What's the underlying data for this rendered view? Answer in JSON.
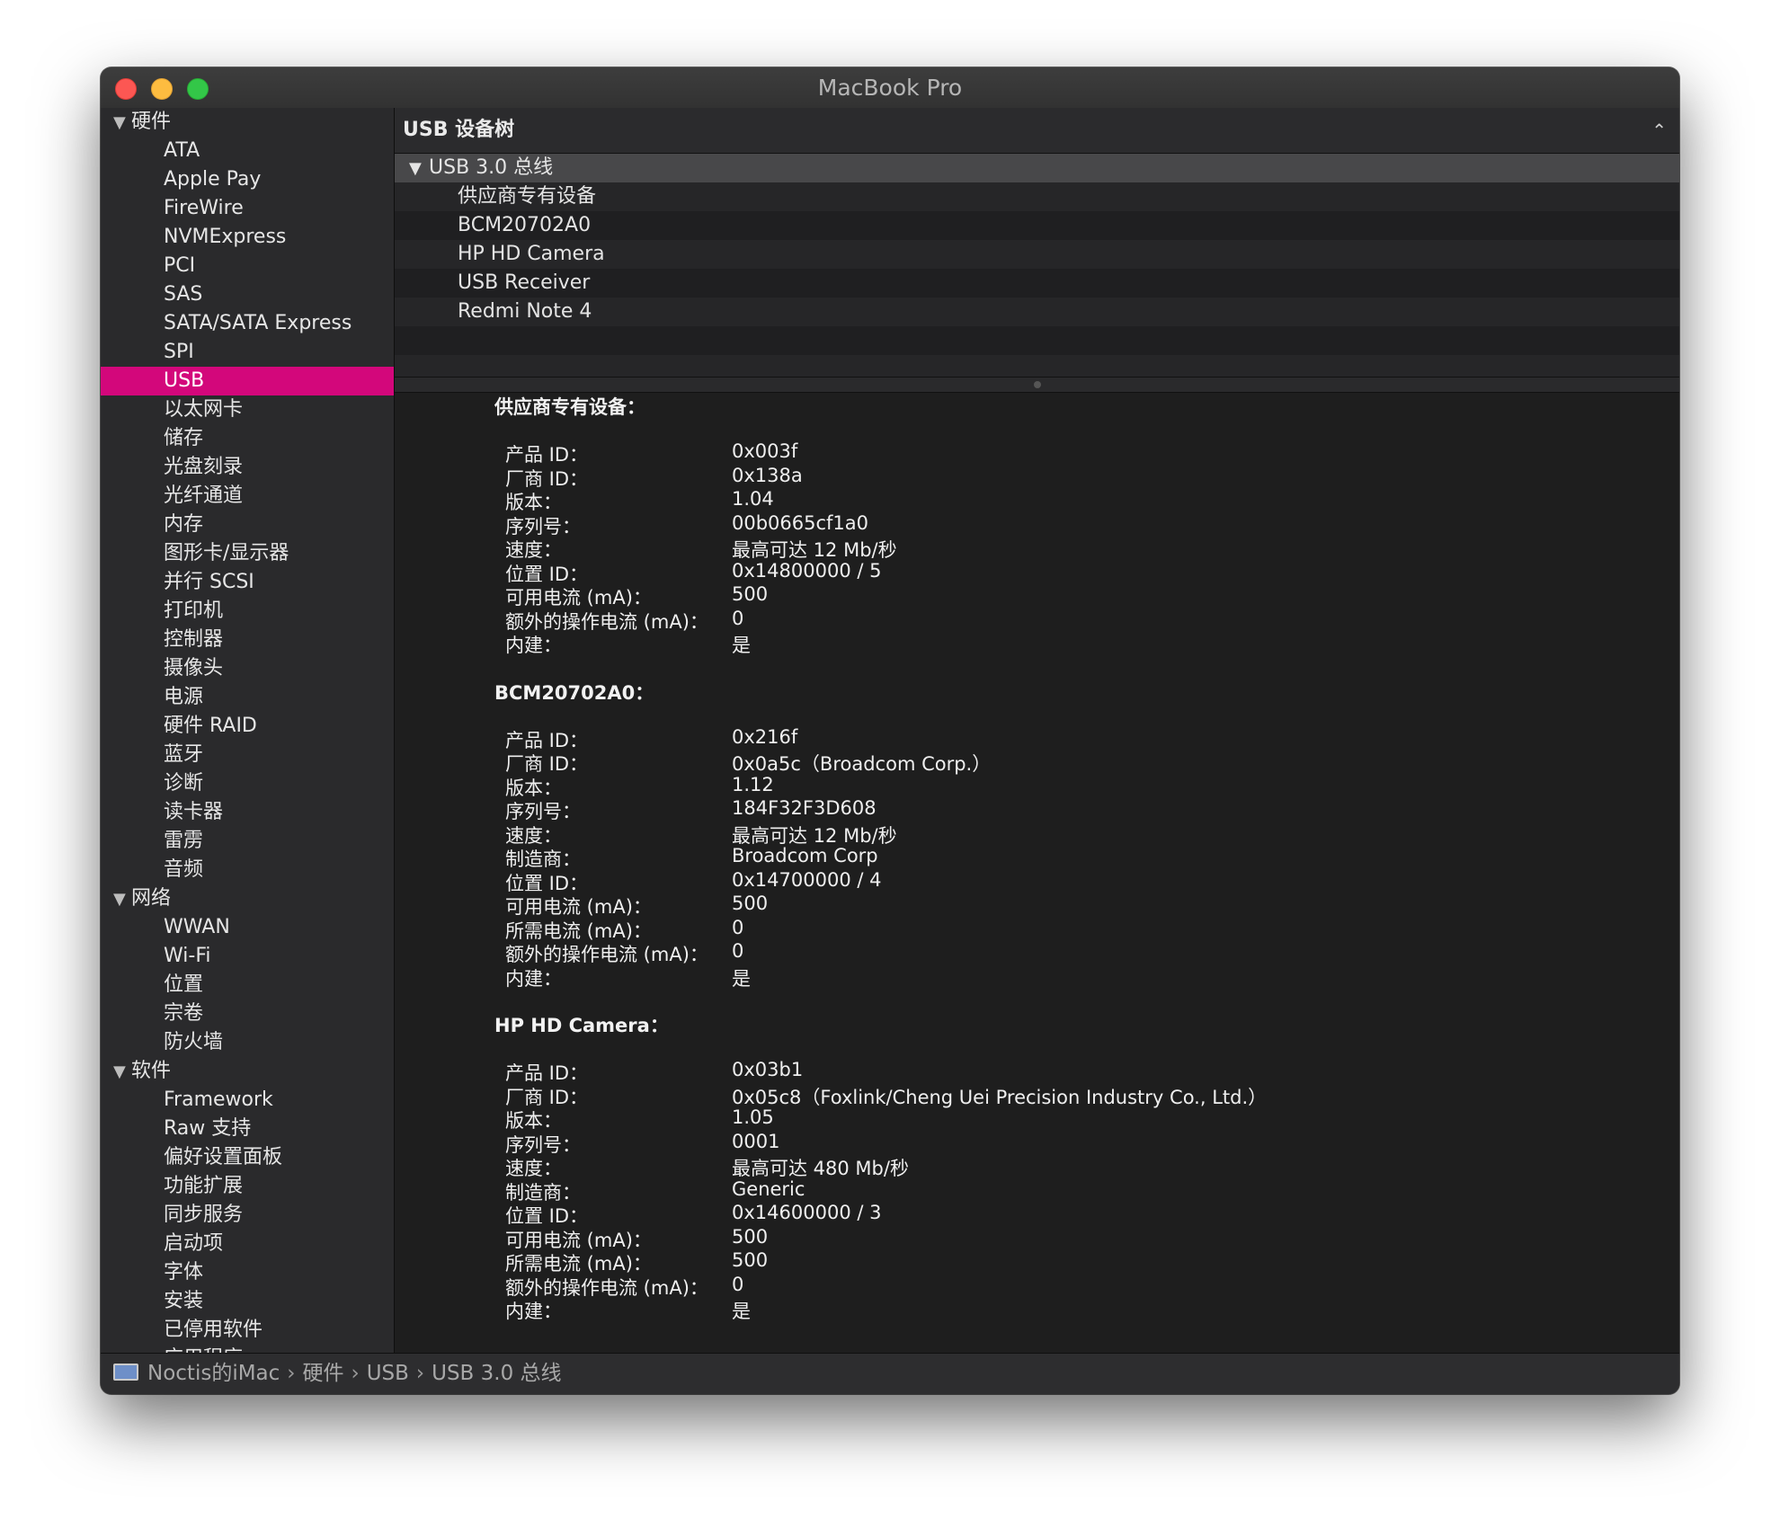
{
  "window": {
    "title": "MacBook Pro"
  },
  "sidebar": {
    "groups": [
      {
        "label": "硬件",
        "items": [
          "ATA",
          "Apple Pay",
          "FireWire",
          "NVMExpress",
          "PCI",
          "SAS",
          "SATA/SATA Express",
          "SPI",
          "USB",
          "以太网卡",
          "储存",
          "光盘刻录",
          "光纤通道",
          "内存",
          "图形卡/显示器",
          "并行 SCSI",
          "打印机",
          "控制器",
          "摄像头",
          "电源",
          "硬件 RAID",
          "蓝牙",
          "诊断",
          "读卡器",
          "雷雳",
          "音频"
        ]
      },
      {
        "label": "网络",
        "items": [
          "WWAN",
          "Wi-Fi",
          "位置",
          "宗卷",
          "防火墙"
        ]
      },
      {
        "label": "软件",
        "items": [
          "Framework",
          "Raw 支持",
          "偏好设置面板",
          "功能扩展",
          "同步服务",
          "启动项",
          "字体",
          "安装",
          "已停用软件",
          "应用程序"
        ]
      }
    ],
    "selected": "USB"
  },
  "tree": {
    "header": "USB 设备树",
    "bus": "USB 3.0 总线",
    "devices": [
      "供应商专有设备",
      "BCM20702A0",
      "HP HD Camera",
      "USB Receiver",
      "Redmi Note 4"
    ]
  },
  "details": [
    {
      "title": "供应商专有设备：",
      "rows": [
        {
          "label": "产品 ID：",
          "value": "0x003f"
        },
        {
          "label": "厂商 ID：",
          "value": "0x138a"
        },
        {
          "label": "版本：",
          "value": "1.04"
        },
        {
          "label": "序列号：",
          "value": "00b0665cf1a0"
        },
        {
          "label": "速度：",
          "value": "最高可达 12 Mb/秒"
        },
        {
          "label": "位置 ID：",
          "value": "0x14800000 / 5"
        },
        {
          "label": "可用电流 (mA)：",
          "value": "500"
        },
        {
          "label": "额外的操作电流 (mA)：",
          "value": "0"
        },
        {
          "label": "内建：",
          "value": "是"
        }
      ]
    },
    {
      "title": "BCM20702A0：",
      "rows": [
        {
          "label": "产品 ID：",
          "value": "0x216f"
        },
        {
          "label": "厂商 ID：",
          "value": "0x0a5c（Broadcom Corp.）"
        },
        {
          "label": "版本：",
          "value": "1.12"
        },
        {
          "label": "序列号：",
          "value": "184F32F3D608"
        },
        {
          "label": "速度：",
          "value": "最高可达 12 Mb/秒"
        },
        {
          "label": "制造商：",
          "value": "Broadcom Corp"
        },
        {
          "label": "位置 ID：",
          "value": "0x14700000 / 4"
        },
        {
          "label": "可用电流 (mA)：",
          "value": "500"
        },
        {
          "label": "所需电流 (mA)：",
          "value": "0"
        },
        {
          "label": "额外的操作电流 (mA)：",
          "value": "0"
        },
        {
          "label": "内建：",
          "value": "是"
        }
      ]
    },
    {
      "title": "HP HD Camera：",
      "rows": [
        {
          "label": "产品 ID：",
          "value": "0x03b1"
        },
        {
          "label": "厂商 ID：",
          "value": "0x05c8（Foxlink/Cheng Uei Precision Industry Co., Ltd.）"
        },
        {
          "label": "版本：",
          "value": "1.05"
        },
        {
          "label": "序列号：",
          "value": "0001"
        },
        {
          "label": "速度：",
          "value": "最高可达 480 Mb/秒"
        },
        {
          "label": "制造商：",
          "value": "Generic"
        },
        {
          "label": "位置 ID：",
          "value": "0x14600000 / 3"
        },
        {
          "label": "可用电流 (mA)：",
          "value": "500"
        },
        {
          "label": "所需电流 (mA)：",
          "value": "500"
        },
        {
          "label": "额外的操作电流 (mA)：",
          "value": "0"
        },
        {
          "label": "内建：",
          "value": "是"
        }
      ]
    }
  ],
  "pathbar": {
    "icon": "imac-icon",
    "crumbs": [
      "Noctis的iMac",
      "硬件",
      "USB",
      "USB 3.0 总线"
    ]
  },
  "colors": {
    "selection": "#d3077b",
    "close": "#fc5753",
    "minimize": "#fdbc40",
    "maximize": "#33c748"
  }
}
